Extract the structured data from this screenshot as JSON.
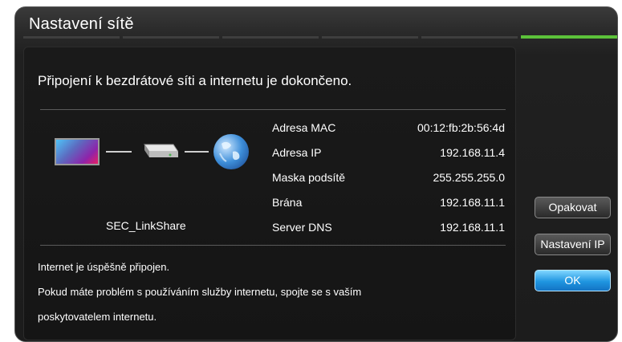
{
  "window": {
    "title": "Nastavení sítě"
  },
  "progress": {
    "steps": 6,
    "active_step": 6
  },
  "main": {
    "status_title": "Připojení k bezdrátové síti a internetu je dokončeno.",
    "access_point_name": "SEC_LinkShare",
    "diagram_icons": [
      "tv-icon",
      "router-icon",
      "globe-icon"
    ],
    "network_info": [
      {
        "label": "Adresa MAC",
        "value": "00:12:fb:2b:56:4d"
      },
      {
        "label": "Adresa IP",
        "value": "192.168.11.4"
      },
      {
        "label": "Maska podsítě",
        "value": "255.255.255.0"
      },
      {
        "label": "Brána",
        "value": "192.168.11.1"
      },
      {
        "label": "Server DNS",
        "value": "192.168.11.1"
      }
    ],
    "message_lines": [
      "Internet je úspěšně připojen.",
      "Pokud máte problém s používáním služby internetu, spojte se s vaším",
      "poskytovatelem internetu."
    ]
  },
  "buttons": {
    "retry": "Opakovat",
    "ip_settings": "Nastavení IP",
    "ok": "OK"
  },
  "colors": {
    "progress_active": "#5cc23a",
    "ok_button": "#1f95e0"
  }
}
